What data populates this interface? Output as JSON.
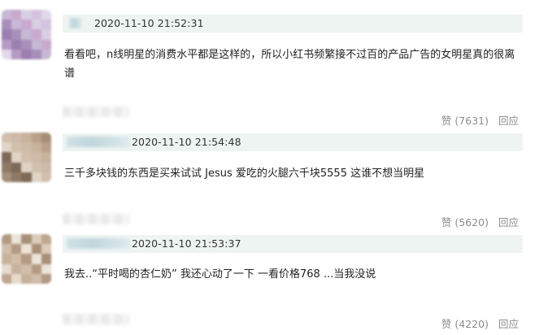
{
  "comments": [
    {
      "avatar_palette": [
        "#c7b8d6",
        "#b59bc4",
        "#d9cfe3",
        "#a88fbb",
        "#e2d8ea",
        "#c9a9cf",
        "#9a7fb0",
        "#d4c3de"
      ],
      "username": "",
      "timestamp": "2020-11-10 21:52:31",
      "text": "看看吧，n线明星的消费水平都是这样的，所以小红书频繁接不过百的产品广告的女明星真的很离谱",
      "like_label": "赞",
      "like_count": "(7631)",
      "reply_label": "回应"
    },
    {
      "avatar_palette": [
        "#b9a089",
        "#d2c0ad",
        "#8f7a66",
        "#c8b39c",
        "#e0d4c6",
        "#a48e78",
        "#cdbba8",
        "#7d6a58"
      ],
      "username": "",
      "timestamp": "2020-11-10 21:54:48",
      "text": "三千多块钱的东西是买来试试 Jesus 爱吃的火腿六千块5555 这谁不想当明星",
      "like_label": "赞",
      "like_count": "(5620)",
      "reply_label": "回应"
    },
    {
      "avatar_palette": [
        "#c9b29c",
        "#dccbb9",
        "#b39a83",
        "#e6dacd",
        "#a88f78",
        "#d1bda9",
        "#bfa68f",
        "#ece3d9"
      ],
      "username": "",
      "timestamp": "2020-11-10 21:53:37",
      "text": "我去..“平时喝的杏仁奶” 我还心动了一下 一看价格768 ...当我没说",
      "like_label": "赞",
      "like_count": "(4220)",
      "reply_label": "回应"
    }
  ]
}
